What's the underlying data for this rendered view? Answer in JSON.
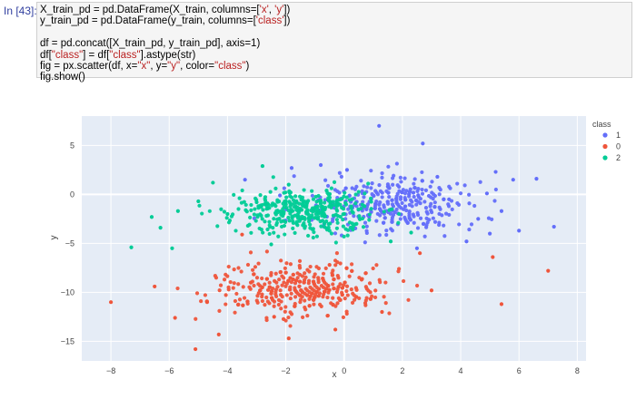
{
  "cell": {
    "prompt": "In [43]:",
    "lines": [
      [
        {
          "t": "X_train_pd = pd.DataFrame(X_train, columns=["
        },
        {
          "t": "'x'",
          "s": 1
        },
        {
          "t": ", "
        },
        {
          "t": "'y'",
          "s": 1
        },
        {
          "t": "])"
        }
      ],
      [
        {
          "t": "y_train_pd = pd.DataFrame(y_train, columns=["
        },
        {
          "t": "'class'",
          "s": 1
        },
        {
          "t": "])"
        }
      ],
      [],
      [
        {
          "t": "df = pd.concat([X_train_pd, y_train_pd], axis=1)"
        }
      ],
      [
        {
          "t": "df["
        },
        {
          "t": "\"class\"",
          "s": 1
        },
        {
          "t": "] = df["
        },
        {
          "t": "\"class\"",
          "s": 1
        },
        {
          "t": "].astype(str)"
        }
      ],
      [
        {
          "t": "fig = px.scatter(df, x="
        },
        {
          "t": "\"x\"",
          "s": 1
        },
        {
          "t": ", y="
        },
        {
          "t": "\"y\"",
          "s": 1
        },
        {
          "t": ", color="
        },
        {
          "t": "\"class\"",
          "s": 1
        },
        {
          "t": ")"
        }
      ],
      [
        {
          "t": "fig.show()"
        }
      ]
    ]
  },
  "colors": {
    "1": "#636efa",
    "0": "#ef553b",
    "2": "#00cc96",
    "plot_bg": "#e5ecf6"
  },
  "chart_data": {
    "type": "scatter",
    "xlabel": "x",
    "ylabel": "y",
    "xlim": [
      -9,
      8.3
    ],
    "ylim": [
      -17,
      8
    ],
    "x_ticks": [
      -8,
      -6,
      -4,
      -2,
      0,
      2,
      4,
      6,
      8
    ],
    "y_ticks": [
      5,
      0,
      -5,
      -10,
      -15
    ],
    "grid": true,
    "legend_title": "class",
    "legend_position": "right",
    "series": [
      {
        "name": "1",
        "color": "#636efa",
        "points": [
          [
            1.2,
            7
          ],
          [
            2.7,
            5.2
          ],
          [
            5.2,
            2.3
          ],
          [
            5.8,
            1.5
          ],
          [
            6.6,
            1.6
          ],
          [
            7.2,
            -3.3
          ],
          [
            6.0,
            -3.7
          ],
          [
            4.9,
            0.1
          ],
          [
            5.4,
            -1.7
          ],
          [
            3.6,
            -0.5
          ],
          [
            -0.8,
            3
          ],
          [
            0.1,
            2.5
          ],
          [
            -1.8,
            2.7
          ],
          [
            2.5,
            -5.5
          ],
          [
            4.2,
            -4.8
          ],
          [
            -3.4,
            1.5
          ],
          [
            -2.2,
            -0.1
          ],
          [
            1.5,
            0.8
          ],
          [
            3.2,
            1.8
          ],
          [
            4.6,
            -2.5
          ],
          [
            5.0,
            -4.0
          ]
        ]
      },
      {
        "name": "0",
        "color": "#ef553b",
        "points": [
          [
            -8.0,
            -11
          ],
          [
            7.0,
            -7.8
          ],
          [
            5.4,
            -11.2
          ],
          [
            5.1,
            -6.4
          ],
          [
            -5.1,
            -15.8
          ],
          [
            -4.3,
            -14.3
          ],
          [
            -1.9,
            -14.7
          ],
          [
            -0.3,
            -13.8
          ],
          [
            -5.8,
            -12.6
          ],
          [
            3.0,
            -9.8
          ],
          [
            -6.5,
            -9.4
          ],
          [
            -3.5,
            -4.1
          ],
          [
            2.6,
            -6.0
          ],
          [
            -2.4,
            -12.5
          ],
          [
            0.6,
            -8.7
          ],
          [
            -1.0,
            -10.5
          ],
          [
            -3.2,
            -9.0
          ],
          [
            1.3,
            -12.0
          ],
          [
            -4.7,
            -11.0
          ],
          [
            -0.5,
            -7.2
          ]
        ]
      },
      {
        "name": "2",
        "color": "#00cc96",
        "points": [
          [
            -7.3,
            -5.4
          ],
          [
            -5.9,
            -5.5
          ],
          [
            -6.3,
            -3.4
          ],
          [
            -6.6,
            -2.3
          ],
          [
            -5.7,
            -1.7
          ],
          [
            -4.5,
            1.2
          ],
          [
            -2.8,
            2.9
          ],
          [
            -3.3,
            -3.2
          ],
          [
            -1.5,
            -1.6
          ],
          [
            0.3,
            -3.6
          ],
          [
            -0.9,
            -2.5
          ],
          [
            -4.0,
            -2.0
          ],
          [
            -1.9,
            1.0
          ],
          [
            0.7,
            -1.2
          ],
          [
            2.3,
            -3.9
          ],
          [
            -3.0,
            -0.8
          ],
          [
            -5.0,
            -0.7
          ],
          [
            -2.5,
            -5.1
          ],
          [
            1.6,
            -4.8
          ],
          [
            -0.6,
            0.4
          ]
        ]
      }
    ],
    "legend": [
      {
        "label": "1",
        "color": "#636efa"
      },
      {
        "label": "0",
        "color": "#ef553b"
      },
      {
        "label": "2",
        "color": "#00cc96"
      }
    ]
  }
}
